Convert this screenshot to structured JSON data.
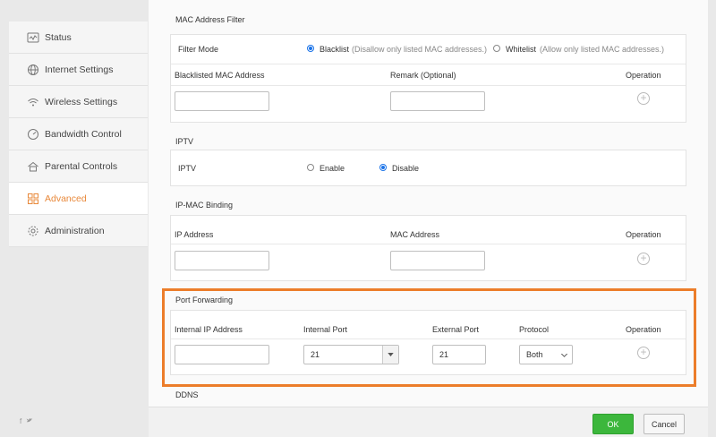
{
  "sidebar": {
    "items": [
      {
        "label": "Status",
        "icon": "status-icon"
      },
      {
        "label": "Internet Settings",
        "icon": "globe-icon"
      },
      {
        "label": "Wireless Settings",
        "icon": "wifi-icon"
      },
      {
        "label": "Bandwidth Control",
        "icon": "gauge-icon"
      },
      {
        "label": "Parental Controls",
        "icon": "house-icon"
      },
      {
        "label": "Advanced",
        "icon": "grid-icon"
      },
      {
        "label": "Administration",
        "icon": "gear-icon"
      }
    ],
    "active": "Advanced"
  },
  "social": {
    "facebook": "f",
    "twitter": "t"
  },
  "mac_filter": {
    "title": "MAC Address Filter",
    "mode_label": "Filter Mode",
    "blacklist_label": "Blacklist",
    "blacklist_hint": "(Disallow only listed MAC addresses.)",
    "whitelist_label": "Whitelist",
    "whitelist_hint": "(Allow only listed MAC addresses.)",
    "selected": "Blacklist",
    "col_mac": "Blacklisted MAC Address",
    "col_remark": "Remark (Optional)",
    "col_operation": "Operation"
  },
  "iptv": {
    "title": "IPTV",
    "label": "IPTV",
    "enable_label": "Enable",
    "disable_label": "Disable",
    "selected": "Disable"
  },
  "ip_mac_binding": {
    "title": "IP-MAC Binding",
    "col_ip": "IP Address",
    "col_mac": "MAC Address",
    "col_operation": "Operation"
  },
  "port_forwarding": {
    "title": "Port Forwarding",
    "col_internal_ip": "Internal IP Address",
    "col_internal_port": "Internal Port",
    "col_external_port": "External Port",
    "col_protocol": "Protocol",
    "col_operation": "Operation",
    "internal_port_value": "21",
    "external_port_value": "21",
    "protocol_value": "Both",
    "highlight_color": "#ec7d2a"
  },
  "ddns": {
    "title": "DDNS"
  },
  "footer": {
    "ok_label": "OK",
    "cancel_label": "Cancel",
    "ok_color": "#3cb73c"
  }
}
